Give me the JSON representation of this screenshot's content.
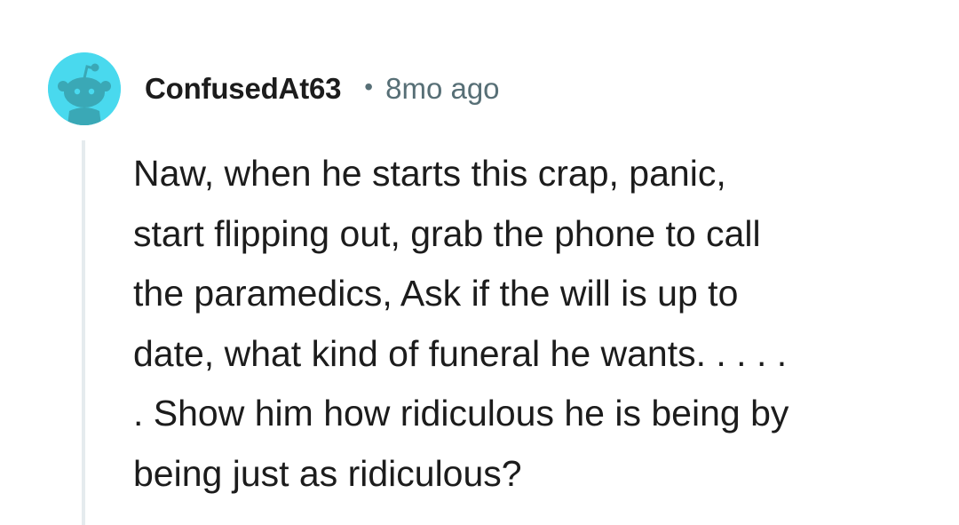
{
  "comment": {
    "avatar_icon": "snoo-avatar-icon",
    "avatar_color": "#49d9ee",
    "username": "ConfusedAt63",
    "separator": "•",
    "timestamp": "8mo ago",
    "body_lines": [
      "Naw, when he starts this crap, panic,",
      "start flipping out, grab the phone to call",
      "the paramedics, Ask if the will is up to",
      "date, what kind of funeral he wants. . . . .",
      ". Show him how ridiculous he is being by",
      "being just as ridiculous?"
    ]
  }
}
